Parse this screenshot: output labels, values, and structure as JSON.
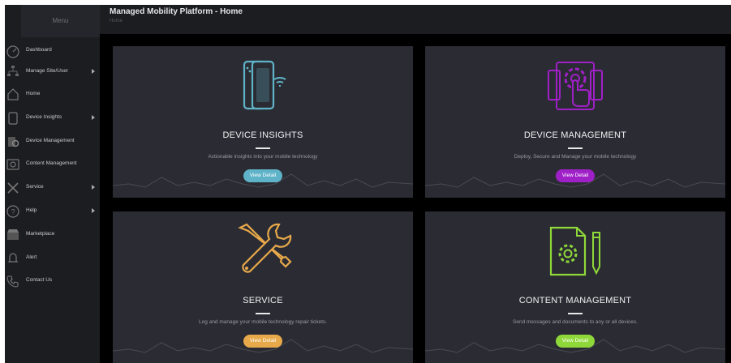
{
  "sidebar": {
    "menu_label": "Menu",
    "items": [
      {
        "label": "Dashboard",
        "icon": "dashboard-icon",
        "has_submenu": false
      },
      {
        "label": "Manage Site/User",
        "icon": "org-chart-icon",
        "has_submenu": true
      },
      {
        "label": "Home",
        "icon": "home-icon",
        "has_submenu": false
      },
      {
        "label": "Device Insights",
        "icon": "device-icon",
        "has_submenu": true
      },
      {
        "label": "Device Management",
        "icon": "device-gear-icon",
        "has_submenu": false
      },
      {
        "label": "Content Management",
        "icon": "content-gear-icon",
        "has_submenu": false
      },
      {
        "label": "Service",
        "icon": "tools-icon",
        "has_submenu": true
      },
      {
        "label": "Help",
        "icon": "help-icon",
        "has_submenu": true
      },
      {
        "label": "Marketplace",
        "icon": "marketplace-icon",
        "has_submenu": false
      },
      {
        "label": "Alert",
        "icon": "bell-icon",
        "has_submenu": false
      },
      {
        "label": "Contact Us",
        "icon": "phone-icon",
        "has_submenu": false
      }
    ]
  },
  "header": {
    "title": "Managed Mobility Platform - Home",
    "breadcrumb": "Home"
  },
  "cards": [
    {
      "title": "DEVICE INSIGHTS",
      "description": "Actionable insights into your mobile technology",
      "button": "View Detail",
      "accent": "#5fb3c8",
      "icon": "mobile-devices-icon"
    },
    {
      "title": "DEVICE MANAGEMENT",
      "description": "Deploy, Secure and Manage your mobile technology",
      "button": "View Detail",
      "accent": "#a020c8",
      "icon": "touch-gear-icon"
    },
    {
      "title": "SERVICE",
      "description": "Log and manage your mobile technology repair tickets.",
      "button": "View Detail",
      "accent": "#e8a94a",
      "icon": "wrench-screwdriver-icon"
    },
    {
      "title": "CONTENT MANAGEMENT",
      "description": "Send messages and documents to any or all devices.",
      "button": "View Detail",
      "accent": "#8fd83a",
      "icon": "document-gear-pencil-icon"
    }
  ],
  "colors": {
    "background": "#000000",
    "panel": "#1c1d21",
    "card": "#2b2c33"
  }
}
